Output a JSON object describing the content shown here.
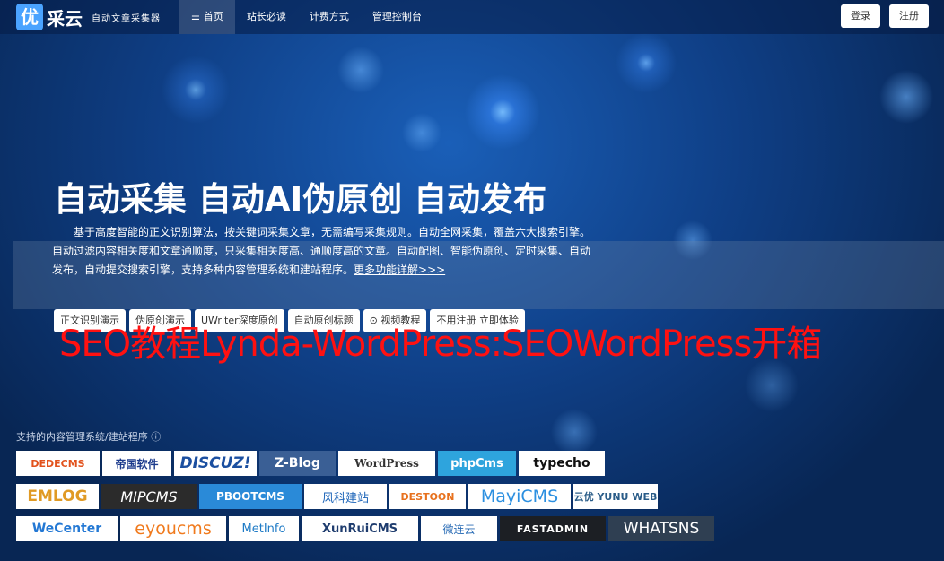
{
  "header": {
    "logo_icon": "优",
    "logo_name": "采云",
    "logo_tagline": "自动文章采集器",
    "nav": [
      {
        "label": "首页",
        "icon": "list-icon",
        "active": true
      },
      {
        "label": "站长必读"
      },
      {
        "label": "计费方式"
      },
      {
        "label": "管理控制台"
      }
    ],
    "login_label": "登录",
    "register_label": "注册"
  },
  "hero": {
    "title": "自动采集 自动AI伪原创 自动发布",
    "description": "基于高度智能的正文识别算法，按关键词采集文章，无需编写采集规则。自动全网采集，覆盖六大搜索引擎。自动过滤内容相关度和文章通顺度，只采集相关度高、通顺度高的文章。自动配图、智能伪原创、定时采集、自动发布，自动提交搜索引擎，支持多种内容管理系统和建站程序。",
    "more_link": "更多功能详解>>>",
    "buttons": [
      "正文识别演示",
      "伪原创演示",
      "UWriter深度原创",
      "自动原创标题",
      "视频教程",
      "不用注册 立即体验"
    ]
  },
  "watermark": "SEO教程Lynda-WordPress:SEOWordPress开箱",
  "cms": {
    "heading": "支持的内容管理系统/建站程序",
    "rows": [
      [
        "DEDECMS",
        "帝国软件",
        "DISCUZ!",
        "Z-Blog",
        "WordPress",
        "phpCms",
        "typecho"
      ],
      [
        "EMLOG",
        "MIPCMS",
        "PBOOTCMS",
        "风科建站",
        "DESTOON",
        "MayiCMS",
        "云优 YUNU WEB"
      ],
      [
        "WeCenter",
        "eyoucms",
        "MetInfo",
        "XunRuiCMS",
        "微连云",
        "FASTADMIN",
        "WHATSNS"
      ]
    ]
  },
  "colors": {
    "accent": "#4aa3ff",
    "watermark": "#ff1111",
    "background": "#0f3f86"
  }
}
